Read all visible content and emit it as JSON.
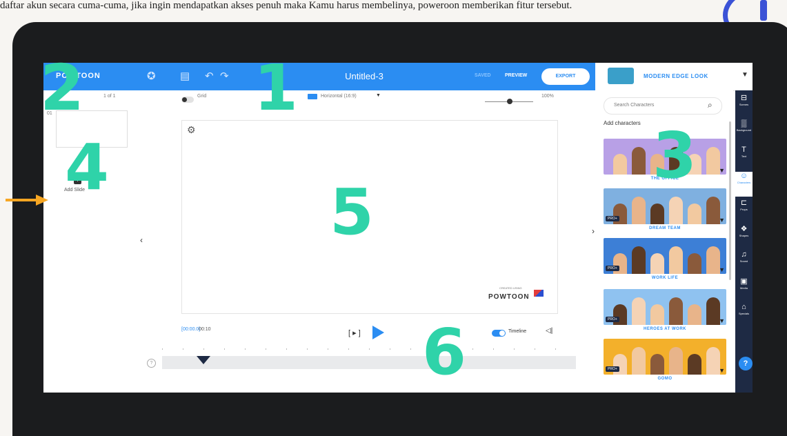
{
  "caption": "daftar akun secara cuma-cuma, jika ingin mendapatkan akses penuh maka Kamu harus membelinya, poweroon memberikan fitur tersebut.",
  "header": {
    "logo": "POWTOON",
    "doc_title": "Untitled-3",
    "saved_label": "SAVED",
    "preview_label": "PREVIEW",
    "export_label": "EXPORT"
  },
  "look": {
    "label": "MODERN EDGE LOOK"
  },
  "toolbar": {
    "slide_count": "1 of 1",
    "grid_label": "Grid",
    "format_label": "Horizontal (16:9)",
    "zoom": "100%"
  },
  "slides": {
    "slide_number": "01",
    "add_label": "Add Slide"
  },
  "canvas": {
    "watermark_small": "CREATED USING",
    "watermark": "POWTOON"
  },
  "timeline": {
    "current_time": "[00:00.0]",
    "total_time": "00:10",
    "play_frame": "[ ▸ ]",
    "timeline_label": "Timeline"
  },
  "panel": {
    "search_placeholder": "Search Characters",
    "add_label": "Add characters",
    "cards": [
      {
        "label": "THE OFFICE",
        "pro": "",
        "bg": "#b8a0e6"
      },
      {
        "label": "DREAM TEAM",
        "pro": "PRO+",
        "bg": "#7fb0e0"
      },
      {
        "label": "WORK LIFE",
        "pro": "PRO+",
        "bg": "#3d7fd6"
      },
      {
        "label": "HEROES AT WORK",
        "pro": "PRO+",
        "bg": "#8fc2f0"
      },
      {
        "label": "GOMO",
        "pro": "PRO+",
        "bg": "#f3b02b"
      }
    ]
  },
  "rail": [
    {
      "icon": "⊟",
      "label": "Scenes"
    },
    {
      "icon": "▒",
      "label": "Background"
    },
    {
      "icon": "T",
      "label": "Text"
    },
    {
      "icon": "☺",
      "label": "Characters"
    },
    {
      "icon": "⊏",
      "label": "Props"
    },
    {
      "icon": "❖",
      "label": "Shapes"
    },
    {
      "icon": "♫",
      "label": "Sound"
    },
    {
      "icon": "▣",
      "label": "Media"
    },
    {
      "icon": "⌂",
      "label": "Specials"
    }
  ],
  "help": "?",
  "annotations": [
    "1",
    "2",
    "3",
    "4",
    "5",
    "6"
  ],
  "colors": {
    "brand_blue": "#2b8df2",
    "annotation_green": "#2fd3a9",
    "rail_navy": "#1e2a44",
    "arrow_orange": "#f6a623"
  }
}
